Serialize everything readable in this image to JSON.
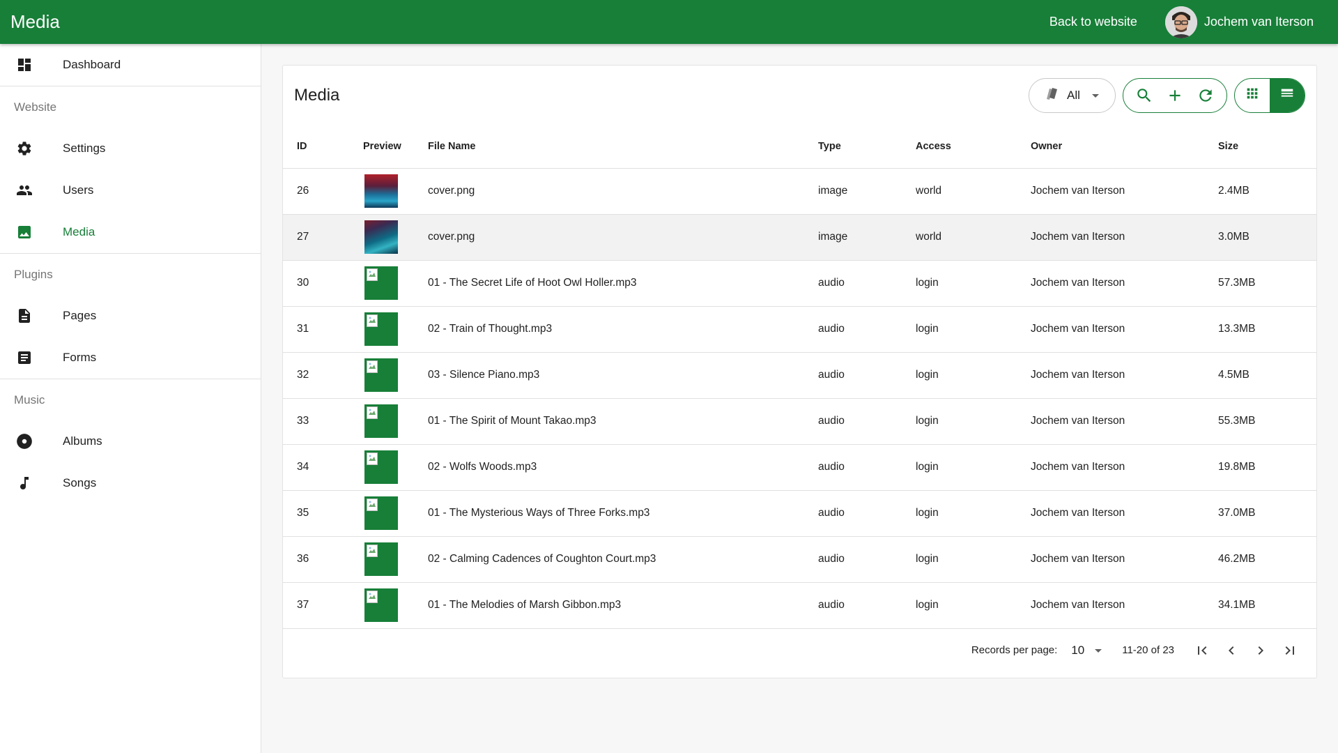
{
  "app": {
    "title": "Media"
  },
  "topbar": {
    "back_label": "Back to website",
    "user_name": "Jochem van Iterson"
  },
  "sidebar": {
    "dashboard": "Dashboard",
    "sections": {
      "website": "Website",
      "plugins": "Plugins",
      "music": "Music"
    },
    "items": {
      "settings": "Settings",
      "users": "Users",
      "media": "Media",
      "pages": "Pages",
      "forms": "Forms",
      "albums": "Albums",
      "songs": "Songs"
    }
  },
  "main": {
    "title": "Media",
    "filter": {
      "label": "All"
    },
    "columns": {
      "id": "ID",
      "preview": "Preview",
      "file_name": "File Name",
      "type": "Type",
      "access": "Access",
      "owner": "Owner",
      "size": "Size"
    },
    "rows": [
      {
        "id": "26",
        "file_name": "cover.png",
        "type": "image",
        "access": "world",
        "owner": "Jochem van Iterson",
        "size": "2.4MB"
      },
      {
        "id": "27",
        "file_name": "cover.png",
        "type": "image",
        "access": "world",
        "owner": "Jochem van Iterson",
        "size": "3.0MB"
      },
      {
        "id": "30",
        "file_name": "01 - The Secret Life of Hoot Owl Holler.mp3",
        "type": "audio",
        "access": "login",
        "owner": "Jochem van Iterson",
        "size": "57.3MB"
      },
      {
        "id": "31",
        "file_name": "02 - Train of Thought.mp3",
        "type": "audio",
        "access": "login",
        "owner": "Jochem van Iterson",
        "size": "13.3MB"
      },
      {
        "id": "32",
        "file_name": "03 - Silence Piano.mp3",
        "type": "audio",
        "access": "login",
        "owner": "Jochem van Iterson",
        "size": "4.5MB"
      },
      {
        "id": "33",
        "file_name": "01 - The Spirit of Mount Takao.mp3",
        "type": "audio",
        "access": "login",
        "owner": "Jochem van Iterson",
        "size": "55.3MB"
      },
      {
        "id": "34",
        "file_name": "02 - Wolfs Woods.mp3",
        "type": "audio",
        "access": "login",
        "owner": "Jochem van Iterson",
        "size": "19.8MB"
      },
      {
        "id": "35",
        "file_name": "01 - The Mysterious Ways of Three Forks.mp3",
        "type": "audio",
        "access": "login",
        "owner": "Jochem van Iterson",
        "size": "37.0MB"
      },
      {
        "id": "36",
        "file_name": "02 - Calming Cadences of Coughton Court.mp3",
        "type": "audio",
        "access": "login",
        "owner": "Jochem van Iterson",
        "size": "46.2MB"
      },
      {
        "id": "37",
        "file_name": "01 - The Melodies of Marsh Gibbon.mp3",
        "type": "audio",
        "access": "login",
        "owner": "Jochem van Iterson",
        "size": "34.1MB"
      }
    ],
    "footer": {
      "records_label": "Records per page:",
      "records_value": "10",
      "range": "11-20 of 23"
    }
  },
  "colors": {
    "brand": "#177f38",
    "hover_row": "#f2f2f2"
  }
}
